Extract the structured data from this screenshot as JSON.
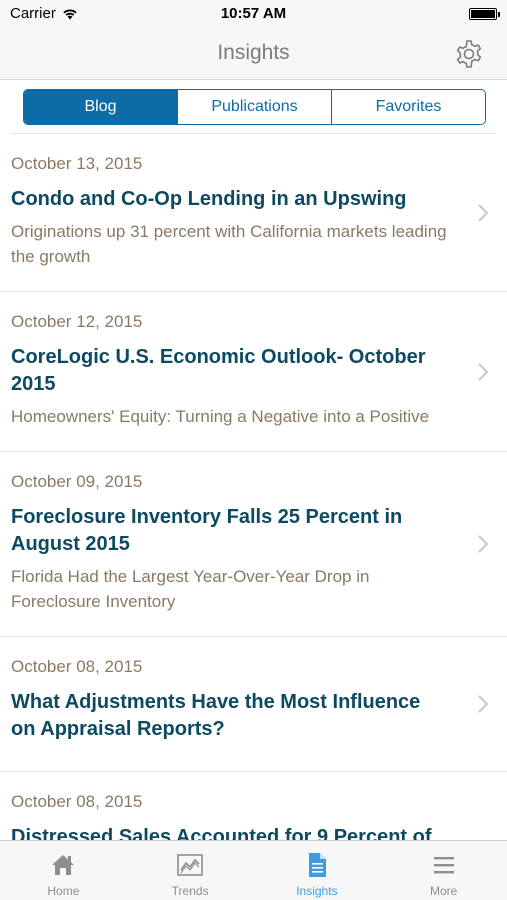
{
  "status_bar": {
    "carrier": "Carrier",
    "time": "10:57 AM"
  },
  "nav": {
    "title": "Insights",
    "settings_icon": "gear-icon"
  },
  "segments": [
    {
      "label": "Blog",
      "active": true
    },
    {
      "label": "Publications",
      "active": false
    },
    {
      "label": "Favorites",
      "active": false
    }
  ],
  "articles": [
    {
      "date": "October 13, 2015",
      "title": "Condo and Co-Op Lending in an Upswing",
      "description": "Originations up 31 percent with California markets leading the growth"
    },
    {
      "date": "October 12, 2015",
      "title": "CoreLogic U.S. Economic Outlook- October 2015",
      "description": "Homeowners' Equity: Turning a Negative into a Positive"
    },
    {
      "date": "October 09, 2015",
      "title": "Foreclosure Inventory Falls 25 Percent in August 2015",
      "description": "Florida Had the Largest Year-Over-Year Drop in Foreclosure Inventory"
    },
    {
      "date": "October 08, 2015",
      "title": "What Adjustments Have the Most Influence on Appraisal Reports?",
      "description": ""
    },
    {
      "date": "October 08, 2015",
      "title": "Distressed Sales Accounted for 9 Percent of",
      "description": ""
    }
  ],
  "tabs": [
    {
      "label": "Home",
      "icon": "home-icon",
      "active": false
    },
    {
      "label": "Trends",
      "icon": "trends-chart-icon",
      "active": false
    },
    {
      "label": "Insights",
      "icon": "document-icon",
      "active": true
    },
    {
      "label": "More",
      "icon": "menu-icon",
      "active": false
    }
  ],
  "colors": {
    "accent": "#0d6ca6",
    "title_text": "#0d4a62",
    "muted_text": "#8a7a62",
    "active_tab": "#3d9de0"
  }
}
